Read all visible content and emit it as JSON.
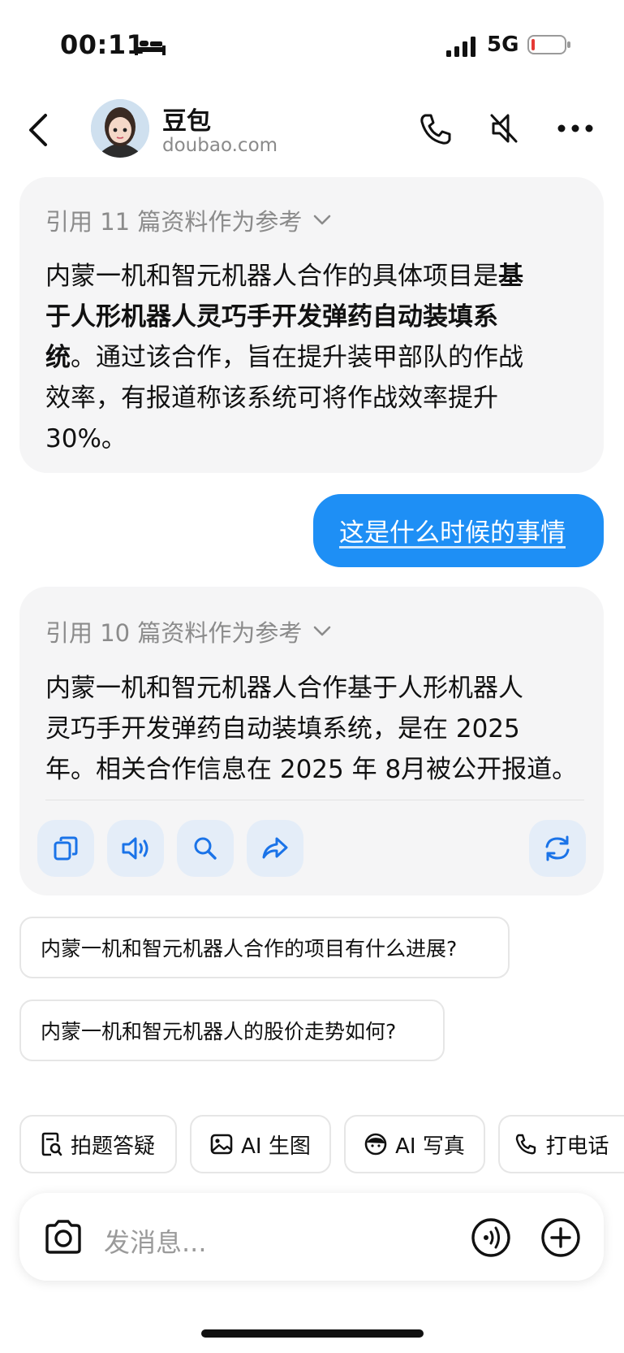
{
  "status": {
    "time": "00:11",
    "network": "5G"
  },
  "header": {
    "name": "豆包",
    "domain": "doubao.com"
  },
  "message1": {
    "cite": "引用  11  篇资料作为参考",
    "lines": [
      {
        "normal": "内蒙一机和智元机器人合作的具体项目是",
        "bold": "基"
      },
      {
        "normal": "",
        "bold": "于人形机器人灵巧手开发弹药自动装填系"
      },
      {
        "bold": "统",
        "normal": "。通过该合作，旨在提升装甲部队的作战"
      },
      {
        "normal": "效率，有报道称该系统可将作战效率提升"
      },
      {
        "normal": " 30%。"
      }
    ]
  },
  "user_message": "这是什么时候的事情",
  "message2": {
    "cite": "引用  10  篇资料作为参考",
    "lines": [
      "内蒙一机和智元机器人合作基于人形机器人",
      "灵巧手开发弹药自动装填系统，是在 2025",
      "年。相关合作信息在 2025 年 8月被公开报道。"
    ]
  },
  "suggestions": [
    "内蒙一机和智元机器人合作的项目有什么进展?",
    "内蒙一机和智元机器人的股价走势如何?"
  ],
  "chips": [
    "拍题答疑",
    "AI 生图",
    "AI 写真",
    "打电话"
  ],
  "input": {
    "placeholder": "发消息..."
  },
  "colors": {
    "accent": "#1e8ff5",
    "card_bg": "#f5f5f6",
    "action_bg": "#e4edf8",
    "action_icon": "#1a73e8"
  },
  "icons": {
    "back": "chevron-left-icon",
    "phone": "phone-icon",
    "mute": "speaker-mute-icon",
    "more": "more-icon",
    "copy": "copy-icon",
    "speaker": "speaker-icon",
    "search": "search-icon",
    "share": "share-icon",
    "regen": "refresh-icon",
    "camera": "camera-icon",
    "voice": "voice-icon",
    "plus": "plus-icon"
  }
}
